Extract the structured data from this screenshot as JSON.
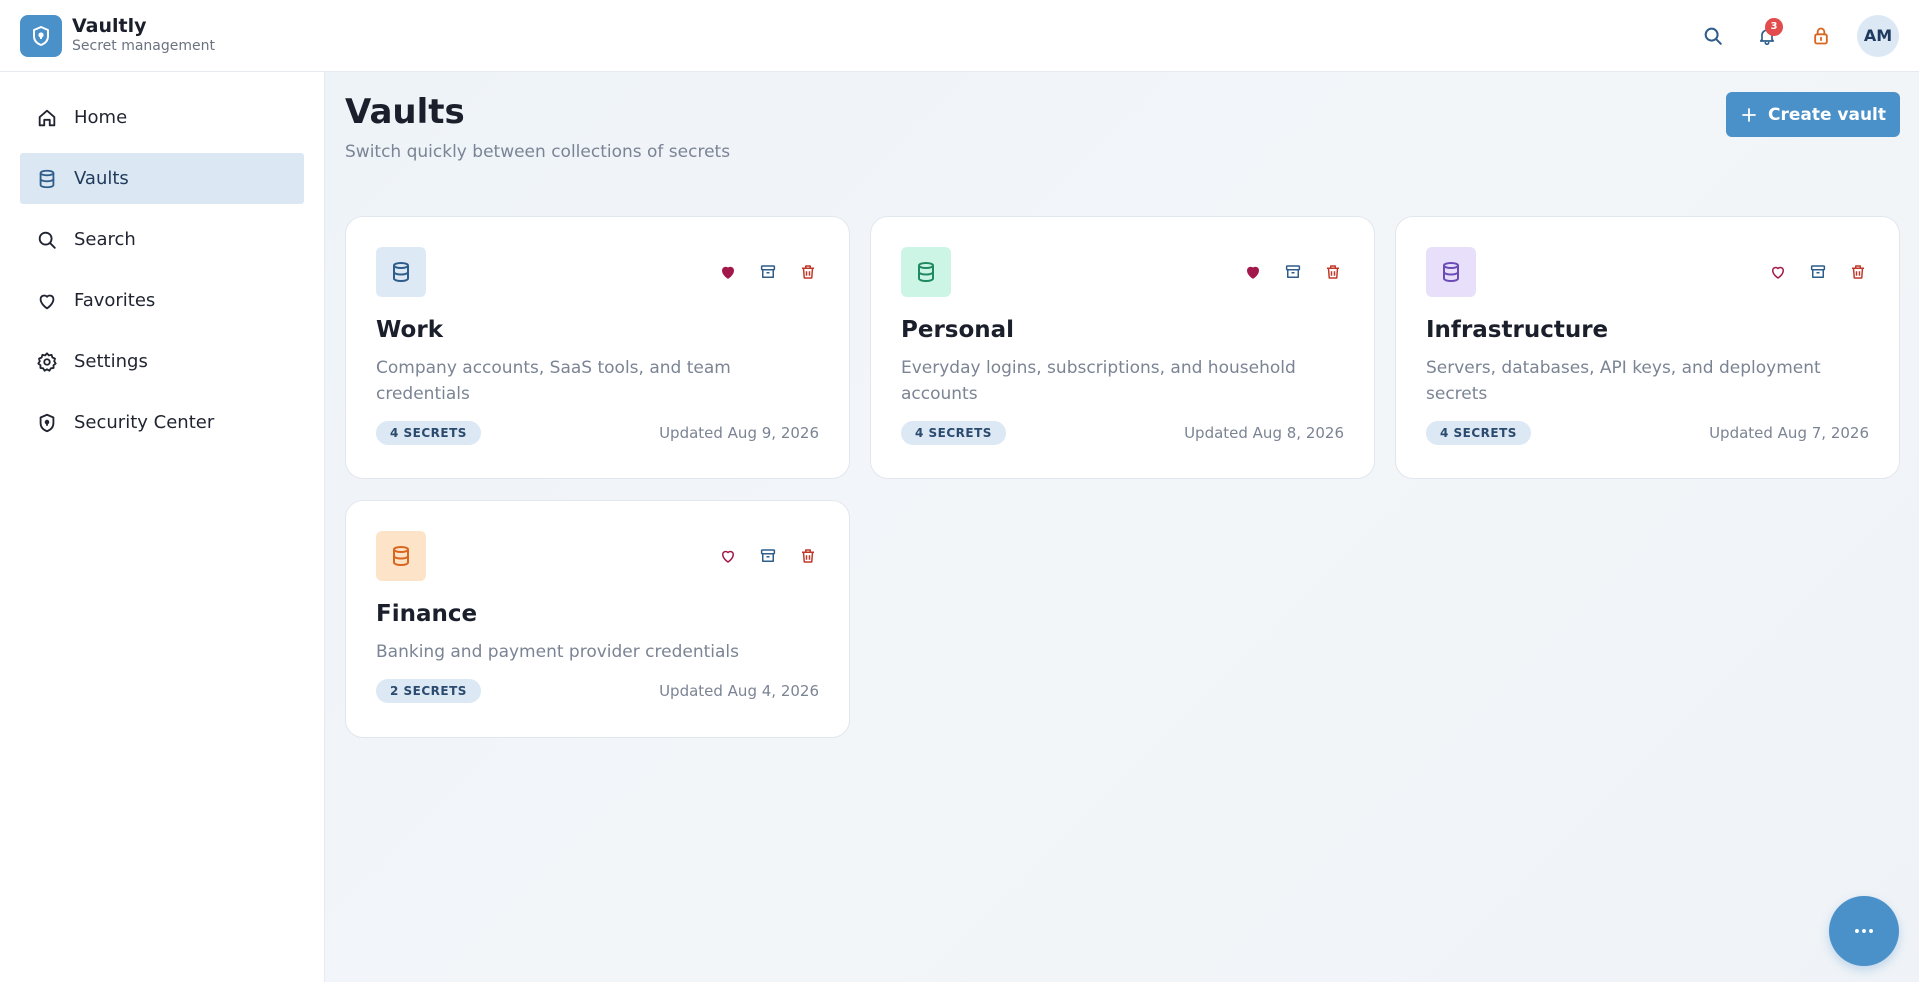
{
  "brand": {
    "name": "Vaultly",
    "subtitle": "Secret management"
  },
  "header": {
    "notifications_count": "3",
    "avatar_initials": "AM"
  },
  "sidebar": {
    "items": [
      {
        "label": "Home",
        "icon": "home-icon",
        "active": false
      },
      {
        "label": "Vaults",
        "icon": "database-icon",
        "active": true
      },
      {
        "label": "Search",
        "icon": "search-icon",
        "active": false
      },
      {
        "label": "Favorites",
        "icon": "heart-icon",
        "active": false
      },
      {
        "label": "Settings",
        "icon": "gear-icon",
        "active": false
      },
      {
        "label": "Security Center",
        "icon": "shield-icon",
        "active": false
      }
    ]
  },
  "main": {
    "title": "Vaults",
    "subtitle": "Switch quickly between collections of secrets",
    "create_label": "Create vault"
  },
  "vaults": [
    {
      "name": "Work",
      "description": "Company accounts, SaaS tools, and team credentials",
      "count": "4 SECRETS",
      "updated": "Updated Aug 9, 2026",
      "favorite": true,
      "icon_bg": "#dde9f5",
      "icon_color": "#2f5d8a"
    },
    {
      "name": "Personal",
      "description": "Everyday logins, subscriptions, and household accounts",
      "count": "4 SECRETS",
      "updated": "Updated Aug 8, 2026",
      "favorite": true,
      "icon_bg": "#cdf5e6",
      "icon_color": "#1f8a5f"
    },
    {
      "name": "Infrastructure",
      "description": "Servers, databases, API keys, and deployment secrets",
      "count": "4 SECRETS",
      "updated": "Updated Aug 7, 2026",
      "favorite": false,
      "icon_bg": "#e8e0fb",
      "icon_color": "#6a4bb8"
    },
    {
      "name": "Finance",
      "description": "Banking and payment provider credentials",
      "count": "2 SECRETS",
      "updated": "Updated Aug 4, 2026",
      "favorite": false,
      "icon_bg": "#fde3c8",
      "icon_color": "#d9661e"
    }
  ],
  "colors": {
    "accent": "#4a90c9",
    "favorite": "#a3184b",
    "archive": "#2f5d8a",
    "delete": "#c0392b",
    "lock": "#d9661e"
  }
}
